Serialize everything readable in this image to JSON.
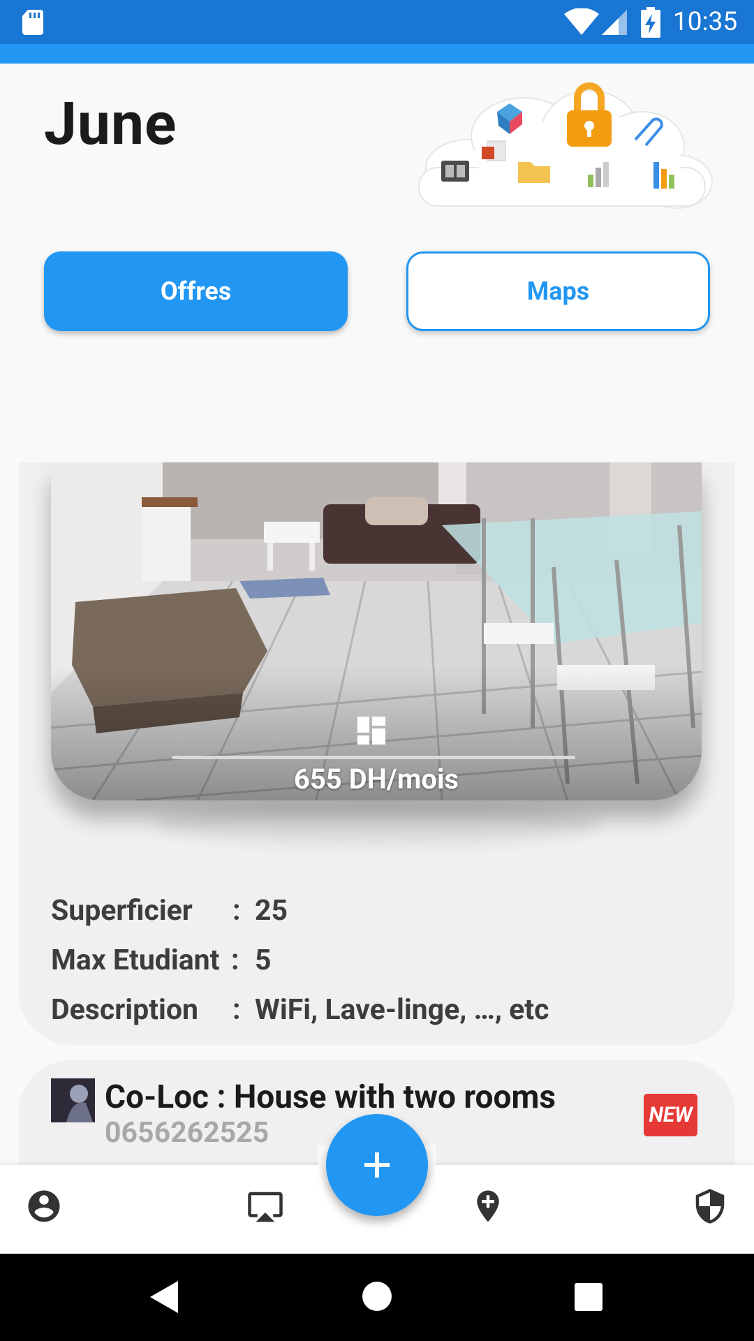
{
  "status_bar": {
    "time": "10:35",
    "icons": [
      "sd-card-icon",
      "wifi-icon",
      "signal-icon",
      "battery-charging-icon"
    ]
  },
  "header": {
    "title": "June",
    "illustration": "cloud-storage-illustration"
  },
  "buttons": {
    "offres_label": "Offres",
    "maps_label": "Maps"
  },
  "offer": {
    "price": "655 DH/mois",
    "details": [
      {
        "label": "Superficier",
        "sep": ":",
        "value": "25"
      },
      {
        "label": "Max Etudiant",
        "sep": ":",
        "value": "5"
      },
      {
        "label": "Description",
        "sep": ":",
        "value": "WiFi, Lave-linge, …, etc"
      }
    ]
  },
  "listing": {
    "title": "Co-Loc : House with two rooms",
    "phone": "0656262525",
    "badge": "NEW"
  },
  "bottom_nav": {
    "items": [
      "account-icon",
      "airplay-icon",
      "add-location-icon",
      "shield-icon"
    ],
    "fab": "add-icon"
  },
  "colors": {
    "primary": "#2196f3",
    "status_bar": "#1976d2",
    "badge": "#e53935"
  }
}
